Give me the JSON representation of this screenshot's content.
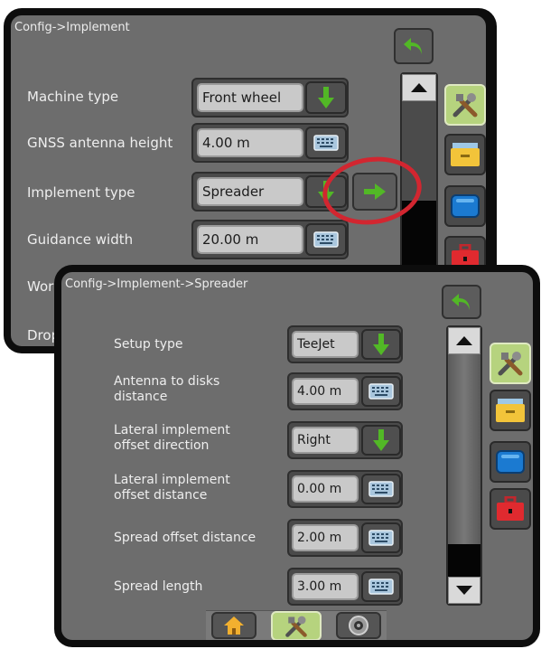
{
  "back_screen": {
    "breadcrumb": "Config->Implement",
    "rows": [
      {
        "label": "Machine type",
        "value": "Front wheel",
        "control": "dropdown-arrow-icon"
      },
      {
        "label": "GNSS antenna height",
        "value": "4.00 m",
        "control": "keyboard-icon"
      },
      {
        "label": "Implement type",
        "value": "Spreader",
        "control": "dropdown-arrow-icon"
      },
      {
        "label": "Guidance width",
        "value": "20.00 m",
        "control": "keyboard-icon"
      },
      {
        "label": "Wor",
        "value": "",
        "control": ""
      },
      {
        "label": "Drop",
        "value": "",
        "control": ""
      }
    ]
  },
  "front_screen": {
    "breadcrumb": "Config->Implement->Spreader",
    "rows": [
      {
        "label_line1": "Setup type",
        "label_line2": "",
        "value": "TeeJet",
        "control": "dropdown-arrow-icon"
      },
      {
        "label_line1": "Antenna to disks",
        "label_line2": "distance",
        "value": "4.00 m",
        "control": "keyboard-icon"
      },
      {
        "label_line1": "Lateral implement",
        "label_line2": "offset direction",
        "value": "Right",
        "control": "dropdown-arrow-icon"
      },
      {
        "label_line1": "Lateral implement",
        "label_line2": "offset distance",
        "value": "0.00 m",
        "control": "keyboard-icon"
      },
      {
        "label_line1": "Spread offset distance",
        "label_line2": "",
        "value": "2.00 m",
        "control": "keyboard-icon"
      },
      {
        "label_line1": "Spread length",
        "label_line2": "",
        "value": "3.00 m",
        "control": "keyboard-icon"
      }
    ],
    "bottom_tabs": [
      "home-icon",
      "tools-icon",
      "camera-icon"
    ]
  },
  "colors": {
    "highlight_circle": "#d22630",
    "accent_green": "#52b826",
    "side_tab_selected": "#b6d37e"
  }
}
